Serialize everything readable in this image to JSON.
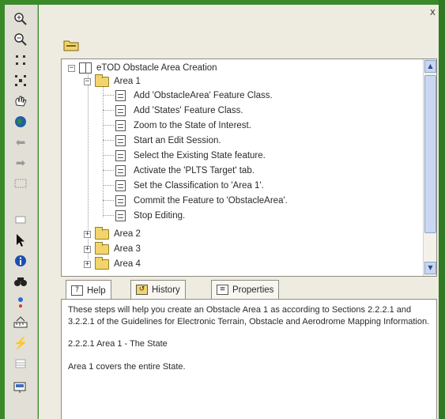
{
  "panel": {
    "close_label": "x"
  },
  "toolbar": {
    "icons": [
      "zoom-in-icon",
      "zoom-out-icon",
      "fixed-zoom-in-icon",
      "fixed-zoom-out-icon",
      "pan-icon",
      "full-extent-icon",
      "back-icon",
      "forward-icon",
      "select-features-icon",
      "clear-selection-icon",
      "select-elements-icon",
      "identify-icon",
      "find-icon",
      "go-to-xy-icon",
      "measure-icon",
      "hyperlink-icon",
      "table-icon",
      "time-slider-icon"
    ]
  },
  "tree": {
    "root": {
      "label": "eTOD Obstacle Area Creation",
      "expander": "−"
    },
    "area1": {
      "label": "Area 1",
      "expander": "−",
      "steps": [
        "Add 'ObstacleArea' Feature Class.",
        "Add 'States' Feature Class.",
        "Zoom to the State of Interest.",
        "Start an Edit Session.",
        "Select the Existing State feature.",
        "Activate the 'PLTS Target' tab.",
        "Set the Classification to 'Area 1'.",
        "Commit the Feature to 'ObstacleArea'.",
        "Stop Editing."
      ]
    },
    "other_areas": [
      {
        "label": "Area 2",
        "expander": "+"
      },
      {
        "label": "Area 3",
        "expander": "+"
      },
      {
        "label": "Area 4",
        "expander": "+"
      }
    ]
  },
  "tabs": [
    {
      "label": "Help",
      "icon": "?"
    },
    {
      "label": "History",
      "icon": "↺"
    },
    {
      "label": "Properties",
      "icon": "≡"
    }
  ],
  "help": {
    "paragraphs": [
      "These steps will help you create an Obstacle Area 1 as according to Sections 2.2.2.1 and 3.2.2.1 of the Guidelines for Electronic Terrain, Obstacle and Aerodrome Mapping Information.",
      "2.2.2.1  Area 1 - The State",
      "Area 1 covers the entire State."
    ]
  }
}
